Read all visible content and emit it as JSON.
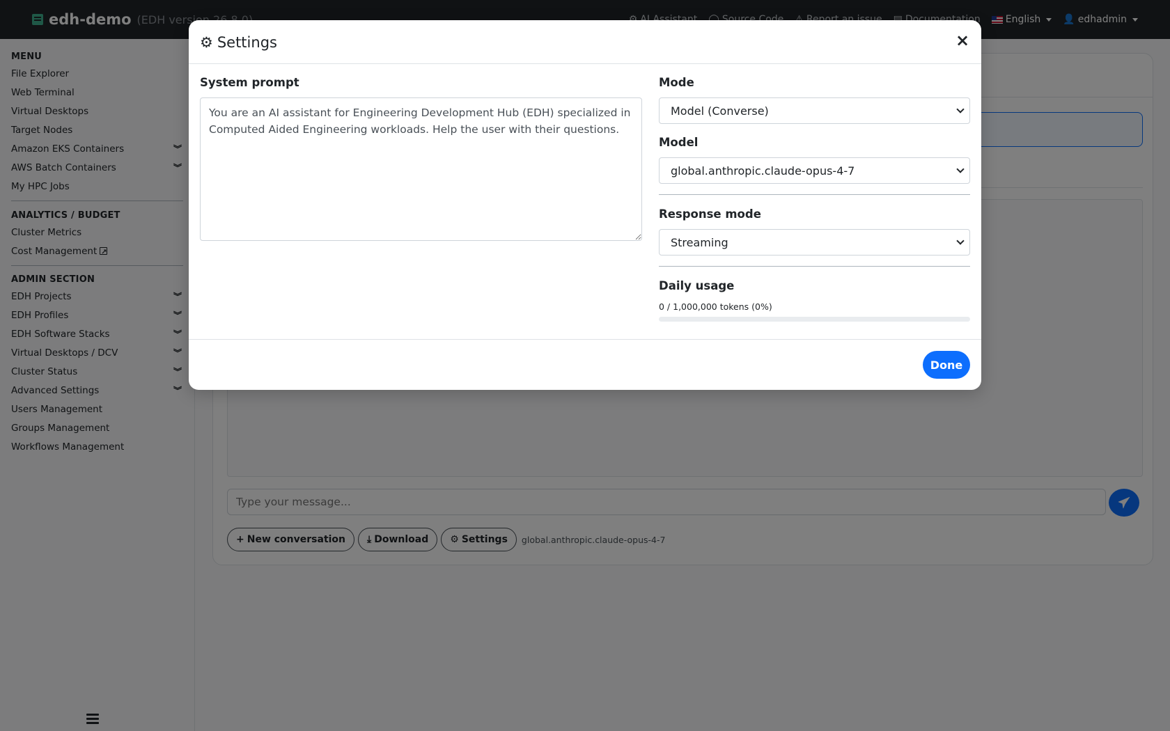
{
  "navbar": {
    "app_name": "edh-demo",
    "version": "(EDH version 26.8.0)",
    "links": {
      "ai_assistant": "AI Assistant",
      "source_code": "Source Code",
      "report_issue": "Report an issue",
      "documentation": "Documentation"
    },
    "language": "English",
    "user": "edhadmin"
  },
  "sidebar": {
    "menu": {
      "header": "MENU",
      "items": [
        "File Explorer",
        "Web Terminal",
        "Virtual Desktops",
        "Target Nodes",
        "Amazon EKS Containers",
        "AWS Batch Containers",
        "My HPC Jobs"
      ]
    },
    "analytics": {
      "header": "ANALYTICS / BUDGET",
      "items": [
        "Cluster Metrics",
        "Cost Management"
      ]
    },
    "admin": {
      "header": "ADMIN SECTION",
      "items": [
        "EDH Projects",
        "EDH Profiles",
        "EDH Software Stacks",
        "Virtual Desktops / DCV",
        "Cluster Status",
        "Advanced Settings",
        "Users Management",
        "Groups Management",
        "Workflows Management"
      ]
    }
  },
  "chat": {
    "input_placeholder": "Type your message...",
    "new_conversation": "New conversation",
    "download": "Download",
    "settings": "Settings",
    "current_model": "global.anthropic.claude-opus-4-7"
  },
  "modal": {
    "title": "Settings",
    "close": "×",
    "system_prompt_label": "System prompt",
    "system_prompt_value": "You are an AI assistant for Engineering Development Hub (EDH) specialized in Computed Aided Engineering workloads. Help the user with their questions.",
    "mode_label": "Mode",
    "mode_value": "Model (Converse)",
    "model_label": "Model",
    "model_value": "global.anthropic.claude-opus-4-7",
    "response_mode_label": "Response mode",
    "response_mode_value": "Streaming",
    "daily_usage_label": "Daily usage",
    "daily_usage_text": "0 / 1,000,000 tokens (0%)",
    "daily_usage_percent": 0,
    "done": "Done"
  },
  "colors": {
    "primary": "#0d6efd",
    "navbar": "#212529",
    "brand_icon": "#3fb08f"
  }
}
